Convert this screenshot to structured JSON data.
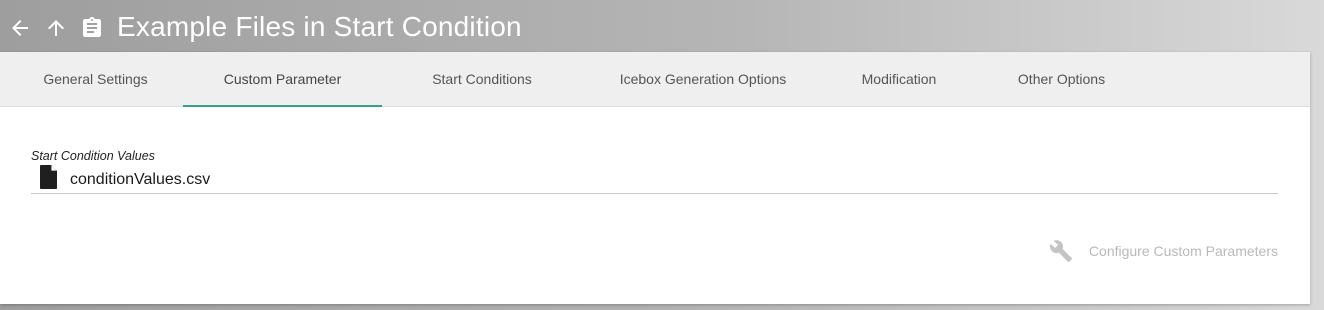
{
  "header": {
    "title": "Example Files in Start Condition",
    "icons": [
      "arrow-left-icon",
      "arrow-up-icon",
      "clipboard-icon"
    ]
  },
  "tabs": [
    {
      "label": "General Settings",
      "active": false
    },
    {
      "label": "Custom Parameter",
      "active": true
    },
    {
      "label": "Start Conditions",
      "active": false
    },
    {
      "label": "Icebox Generation Options",
      "active": false
    },
    {
      "label": "Modification",
      "active": false
    },
    {
      "label": "Other Options",
      "active": false
    }
  ],
  "content": {
    "field_label": "Start Condition Values",
    "file_name": "conditionValues.csv",
    "file_icon": "file-icon",
    "configure_button": "Configure Custom Parameters",
    "configure_icon": "wrench-icon"
  },
  "colors": {
    "accent": "#3a9e8f",
    "disabled_text": "#b9b9b9"
  }
}
